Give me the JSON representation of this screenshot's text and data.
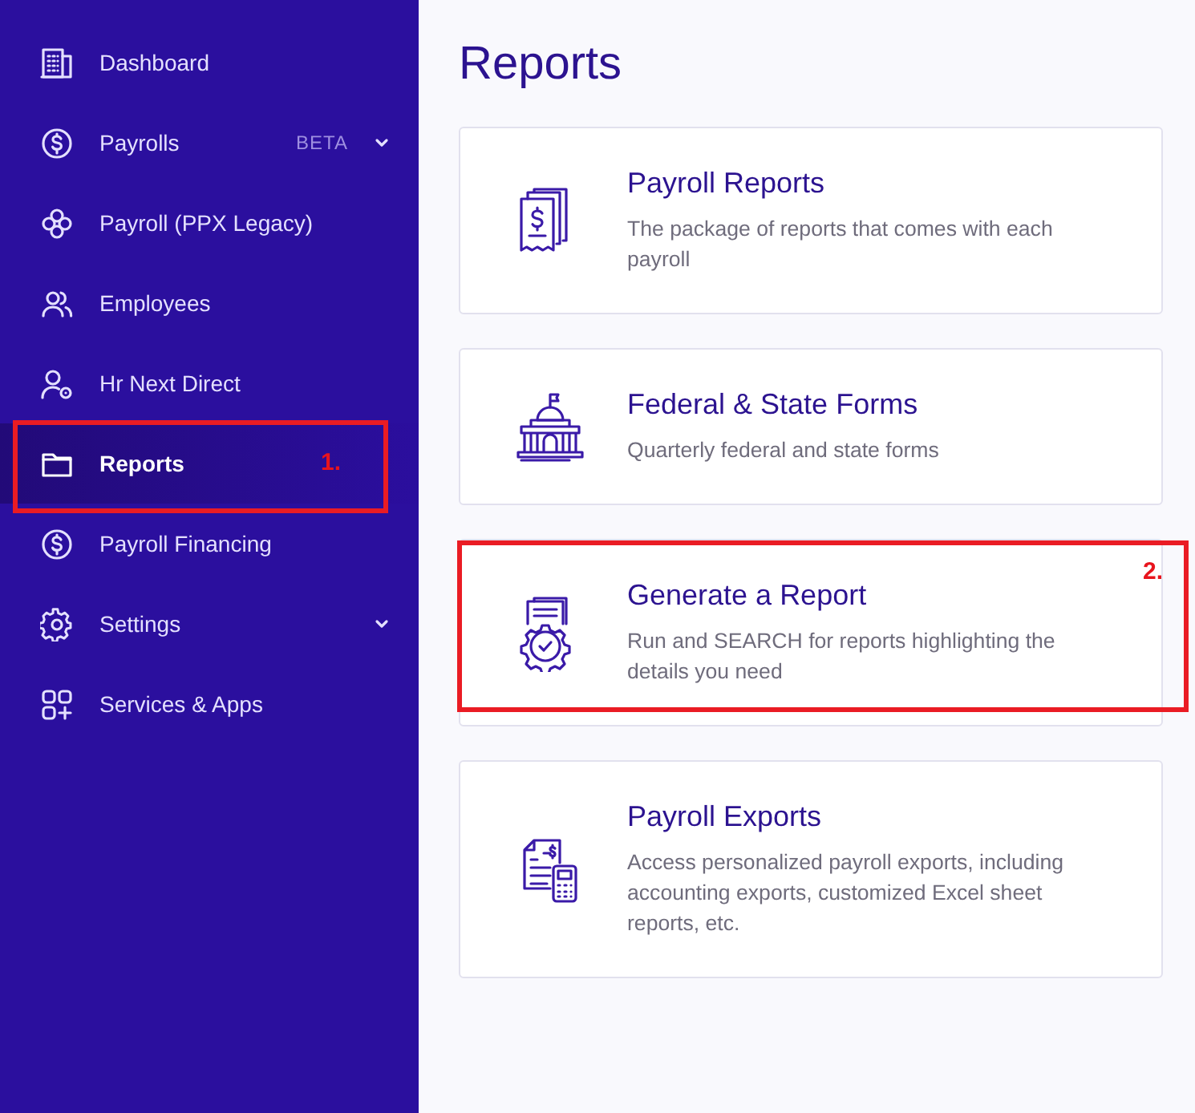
{
  "sidebar": {
    "items": [
      {
        "label": "Dashboard",
        "kind": "building",
        "selected": false,
        "expandable": false
      },
      {
        "label": "Payrolls",
        "kind": "dollar",
        "badge": "BETA",
        "selected": false,
        "expandable": true
      },
      {
        "label": "Payroll (PPX Legacy)",
        "kind": "flower",
        "selected": false,
        "expandable": false
      },
      {
        "label": "Employees",
        "kind": "people",
        "selected": false,
        "expandable": false
      },
      {
        "label": "Hr Next Direct",
        "kind": "person",
        "selected": false,
        "expandable": false
      },
      {
        "label": "Reports",
        "kind": "folder",
        "selected": true,
        "expandable": false,
        "annotation": "1."
      },
      {
        "label": "Payroll Financing",
        "kind": "dollar",
        "selected": false,
        "expandable": false
      },
      {
        "label": "Settings",
        "kind": "gear",
        "selected": false,
        "expandable": true
      },
      {
        "label": "Services & Apps",
        "kind": "grid",
        "selected": false,
        "expandable": false
      }
    ]
  },
  "main": {
    "title": "Reports",
    "cards": [
      {
        "kind": "receipt",
        "title": "Payroll Reports",
        "description": "The package of reports that comes with each payroll"
      },
      {
        "kind": "capitol",
        "title": "Federal & State Forms",
        "description": "Quarterly federal and state forms"
      },
      {
        "kind": "doc-gear",
        "title": "Generate a Report",
        "description": "Run and SEARCH for reports highlighting the details you need",
        "annotation": "2."
      },
      {
        "kind": "calculator",
        "title": "Payroll Exports",
        "description": "Access personalized payroll exports, including accounting exports, customized Excel sheet reports, etc."
      }
    ]
  }
}
